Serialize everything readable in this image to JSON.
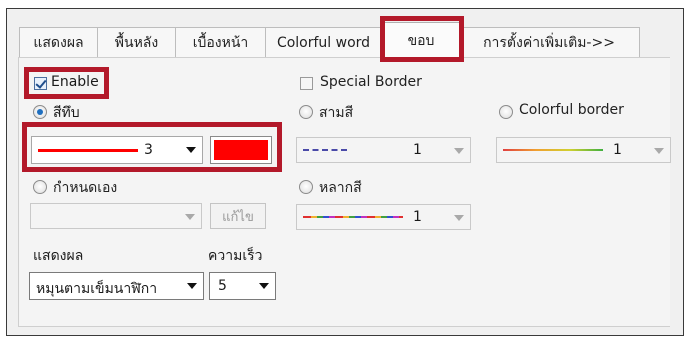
{
  "tabs": [
    {
      "label": "แสดงผล"
    },
    {
      "label": "พื้นหลัง"
    },
    {
      "label": "เบื้องหน้า"
    },
    {
      "label": "Colorful word"
    },
    {
      "label": "ขอบ"
    },
    {
      "label": "การตั้งค่าเพิ่มเติม->>"
    }
  ],
  "enable": {
    "label": "Enable",
    "checked": true
  },
  "solid": {
    "label": "สีทึบ",
    "selected": true,
    "thickness_value": "3",
    "color": "#ff0000"
  },
  "custom": {
    "label": "กำหนดเอง",
    "edit_label": "แก้ไข"
  },
  "display": {
    "label": "แสดงผล",
    "value": "หมุนตามเข็มนาฬิกา"
  },
  "speed": {
    "label": "ความเร็ว",
    "value": "5"
  },
  "special_border": {
    "label": "Special Border",
    "checked": false
  },
  "three_color": {
    "label": "สามสี",
    "value": "1"
  },
  "multi_color": {
    "label": "หลากสี",
    "value": "1"
  },
  "colorful_border": {
    "label": "Colorful border",
    "value": "1"
  },
  "colors": {
    "highlight": "#b3192a",
    "solid_line": "#ff0000"
  }
}
